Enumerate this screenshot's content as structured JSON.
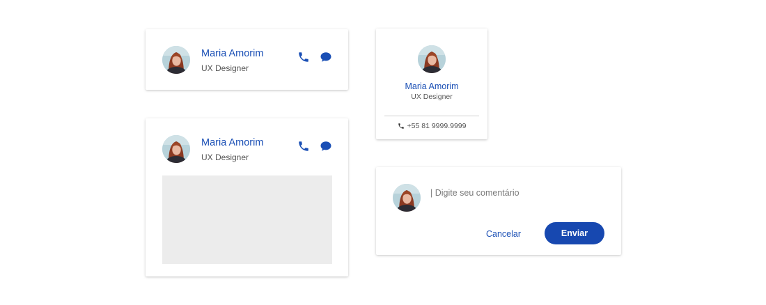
{
  "colors": {
    "accent": "#1a4fb5",
    "button": "#1748b0",
    "placeholder_media": "#ececec"
  },
  "contact_card": {
    "name": "Maria Amorim",
    "role": "UX Designer",
    "actions": [
      {
        "icon": "phone-icon"
      },
      {
        "icon": "chat-bubble-icon"
      }
    ]
  },
  "media_card": {
    "name": "Maria Amorim",
    "role": "UX Designer",
    "actions": [
      {
        "icon": "phone-icon"
      },
      {
        "icon": "chat-bubble-icon"
      }
    ]
  },
  "profile_card": {
    "name": "Maria Amorim",
    "role": "UX Designer",
    "phone": "+55 81 9999.9999"
  },
  "comment_card": {
    "placeholder": "| Digite seu comentário",
    "cancel_label": "Cancelar",
    "send_label": "Enviar"
  }
}
